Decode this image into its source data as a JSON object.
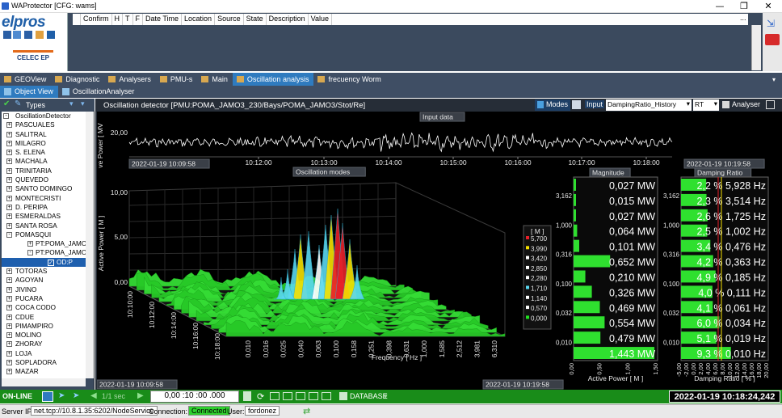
{
  "window": {
    "title": "WAProtector [CFG: wams]",
    "minimize": "—",
    "restore": "❐",
    "close": "✕"
  },
  "logo": {
    "brand": "elpros",
    "sub": "CELEC EP"
  },
  "events": {
    "columns": [
      "",
      "Confirm",
      "H",
      "T",
      "F",
      "Date Time",
      "Location",
      "Source",
      "State",
      "Description",
      "Value"
    ],
    "more": "..."
  },
  "tabs": [
    {
      "label": "GEOView",
      "active": false
    },
    {
      "label": "Diagnostic",
      "active": false
    },
    {
      "label": "Analysers",
      "active": false
    },
    {
      "label": "PMU-s",
      "active": false
    },
    {
      "label": "Main",
      "active": false
    },
    {
      "label": "Oscillation analysis",
      "active": true
    },
    {
      "label": "frecuency Worm",
      "active": false
    }
  ],
  "subtabs": [
    {
      "label": "Object View",
      "active": true
    },
    {
      "label": "OscillationAnalyser",
      "active": false
    }
  ],
  "sidebar": {
    "header": "Types"
  },
  "tree": [
    {
      "label": "OscillationDetector",
      "level": 0,
      "sign": "-"
    },
    {
      "label": "PASCUALES",
      "level": 1,
      "sign": "+"
    },
    {
      "label": "SALITRAL",
      "level": 1,
      "sign": "+"
    },
    {
      "label": "MILAGRO",
      "level": 1,
      "sign": "+"
    },
    {
      "label": "S. ELENA",
      "level": 1,
      "sign": "+"
    },
    {
      "label": "MACHALA",
      "level": 1,
      "sign": "+"
    },
    {
      "label": "TRINITARIA",
      "level": 1,
      "sign": "+"
    },
    {
      "label": "QUEVEDO",
      "level": 1,
      "sign": "+"
    },
    {
      "label": "SANTO DOMINGO",
      "level": 1,
      "sign": "+"
    },
    {
      "label": "MONTECRISTI",
      "level": 1,
      "sign": "+"
    },
    {
      "label": "D. PERIPA",
      "level": 1,
      "sign": "+"
    },
    {
      "label": "ESMERALDAS",
      "level": 1,
      "sign": "+"
    },
    {
      "label": "SANTA ROSA",
      "level": 1,
      "sign": "+"
    },
    {
      "label": "POMASQUI",
      "level": 1,
      "sign": "-"
    },
    {
      "label": "PT:POMA_JAMO",
      "level": 2,
      "sign": "+"
    },
    {
      "label": "PT:POMA_JAMO",
      "level": 2,
      "sign": "-"
    },
    {
      "label": "OD:P",
      "level": 3,
      "sign": "",
      "selected": true
    },
    {
      "label": "TOTORAS",
      "level": 1,
      "sign": "+"
    },
    {
      "label": "AGOYAN",
      "level": 1,
      "sign": "+"
    },
    {
      "label": "JIVINO",
      "level": 1,
      "sign": "+"
    },
    {
      "label": "PUCARA",
      "level": 1,
      "sign": "+"
    },
    {
      "label": "COCA CODO",
      "level": 1,
      "sign": "+"
    },
    {
      "label": "CDUE",
      "level": 1,
      "sign": "+"
    },
    {
      "label": "PIMAMPIRO",
      "level": 1,
      "sign": "+"
    },
    {
      "label": "MOLINO",
      "level": 1,
      "sign": "+"
    },
    {
      "label": "ZHORAY",
      "level": 1,
      "sign": "+"
    },
    {
      "label": "LOJA",
      "level": 1,
      "sign": "+"
    },
    {
      "label": "SOPLADORA",
      "level": 1,
      "sign": "+"
    },
    {
      "label": "MAZAR",
      "level": 1,
      "sign": "+"
    }
  ],
  "panel": {
    "title": "Oscillation detector [PMU:POMA_JAMO3_230/Bays/POMA_JAMO3/Stot/Re]",
    "modes_btn": "Modes",
    "input_label": "Input",
    "input_value": "DampingRatio_History",
    "rt_value": "RT",
    "analyser_btn": "Analyser"
  },
  "input_chart": {
    "tag": "Input data",
    "ylabel": "ve Power [ MV",
    "ytick": "20,00",
    "xticks": [
      "10:12:00",
      "10:13:00",
      "10:14:00",
      "10:15:00",
      "10:16:00",
      "10:17:00",
      "10:18:00"
    ],
    "start": "2022-01-19 10:09:58",
    "end": "2022-01-19 10:19:58"
  },
  "modes_chart": {
    "tag": "Oscillation modes",
    "zlabel": "Active Power [ M ]",
    "zticks": [
      "10,00",
      "5,00",
      "0,00"
    ],
    "time_ticks": [
      "10:10:00",
      "10:12:00",
      "10:14:00",
      "10:16:00",
      "10:18:00"
    ],
    "freq_ticks": [
      "0,010",
      "0,016",
      "0,025",
      "0,040",
      "0,063",
      "0,100",
      "0,158",
      "0,251",
      "0,398",
      "0,631",
      "1,000",
      "1,585",
      "2,512",
      "3,981",
      "6,310"
    ],
    "xlabel": "Frequency [ Hz ]",
    "bottom_start": "2022-01-19 10:09:58",
    "bottom_end": "2022-01-19 10:19:58"
  },
  "legend": {
    "title": "[ M ]",
    "items": [
      {
        "value": "5,700",
        "color": "#e8202a"
      },
      {
        "value": "3,990",
        "color": "#f5e000"
      },
      {
        "value": "3,420",
        "color": "#ffffff"
      },
      {
        "value": "2,850",
        "color": "#ffffff"
      },
      {
        "value": "2,280",
        "color": "#ffffff"
      },
      {
        "value": "1,710",
        "color": "#5ad8f0"
      },
      {
        "value": "1,140",
        "color": "#ffffff"
      },
      {
        "value": "0,570",
        "color": "#ffffff"
      },
      {
        "value": "0,000",
        "color": "#22e022"
      }
    ]
  },
  "chart_data": [
    {
      "type": "bar",
      "title": "Magnitude",
      "xlabel": "Active Power [ M ]",
      "y_ticks": [
        "3,162",
        "1,000",
        "0,316",
        "0,100",
        "0,032",
        "0,010"
      ],
      "x_ticks": [
        "0,00",
        "0,50",
        "1,00",
        "1,50"
      ],
      "bars": [
        {
          "label": "0,027 MW",
          "value": 0.027
        },
        {
          "label": "0,015 MW",
          "value": 0.015
        },
        {
          "label": "0,027 MW",
          "value": 0.027
        },
        {
          "label": "0,064 MW",
          "value": 0.064
        },
        {
          "label": "0,101 MW",
          "value": 0.101
        },
        {
          "label": "0,652 MW",
          "value": 0.652
        },
        {
          "label": "0,210 MW",
          "value": 0.21
        },
        {
          "label": "0,326 MW",
          "value": 0.326
        },
        {
          "label": "0,469 MW",
          "value": 0.469
        },
        {
          "label": "0,554 MW",
          "value": 0.554
        },
        {
          "label": "0,479 MW",
          "value": 0.479
        },
        {
          "label": "1,443 MW",
          "value": 1.443
        }
      ],
      "xlim": [
        0,
        1.5
      ]
    },
    {
      "type": "bar",
      "title": "Damping Ratio",
      "xlabel": "Damping Ratio [ % ]",
      "y_ticks": [
        "3,162",
        "1,000",
        "0,316",
        "0,100",
        "0,032",
        "0,010"
      ],
      "x_ticks": [
        "-5,00",
        "-2,00",
        "0,00",
        "2,00",
        "4,00",
        "6,00",
        "8,00",
        "10,00",
        "12,00",
        "14,00",
        "16,00",
        "18,00",
        "20,00"
      ],
      "bars": [
        {
          "label": "2,2 % 5,928 Hz",
          "value": 2.2
        },
        {
          "label": "2,3 % 3,514 Hz",
          "value": 2.3
        },
        {
          "label": "2,6 % 1,725 Hz",
          "value": 2.6
        },
        {
          "label": "2,5 % 1,002 Hz",
          "value": 2.5
        },
        {
          "label": "3,4 % 0,476 Hz",
          "value": 3.4
        },
        {
          "label": "4,2 % 0,363 Hz",
          "value": 4.2
        },
        {
          "label": "4,9 % 0,185 Hz",
          "value": 4.9
        },
        {
          "label": "4,0 % 0,111 Hz",
          "value": 4.0
        },
        {
          "label": "4,1 % 0,061 Hz",
          "value": 4.1
        },
        {
          "label": "6,0 % 0,034 Hz",
          "value": 6.0
        },
        {
          "label": "5,1 % 0,019 Hz",
          "value": 5.1
        },
        {
          "label": "9,3 % 0,010 Hz",
          "value": 9.3
        }
      ],
      "xlim": [
        -5,
        20
      ]
    }
  ],
  "status": {
    "online": "ON-LINE",
    "speed": "1/1 sec",
    "time_input": "0,00 :10 :00 .000",
    "database": "DATABASE",
    "datetime": "2022-01-19 10:18:24,242"
  },
  "server": {
    "label": "Server IP:",
    "ip": "net.tcp://10.8.1.35:6202/NodeService",
    "conn_label": "Connection:",
    "conn_value": "Connected",
    "user_label": "User:",
    "user_value": "fordonez"
  },
  "colors": {
    "accent": "#2f7bbf",
    "status_green": "#198c19",
    "bar_green": "#2fe02f",
    "connected_bg": "#2fd02f"
  }
}
